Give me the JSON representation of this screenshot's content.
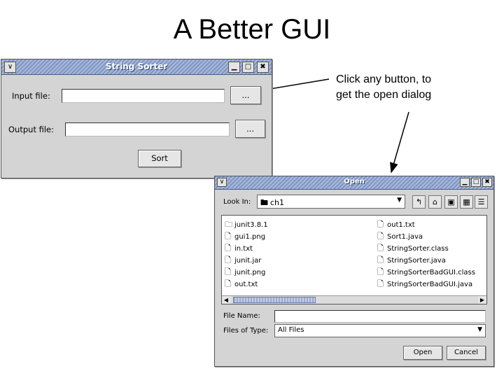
{
  "slide": {
    "title": "A Better GUI",
    "annotation_line1": "Click any button, to",
    "annotation_line2": "get the open dialog"
  },
  "string_sorter": {
    "title": "String Sorter",
    "input_label": "Input file:",
    "input_value": "",
    "browse_label": "...",
    "output_label": "Output file:",
    "output_value": "",
    "sort_label": "Sort"
  },
  "open_dialog": {
    "title": "Open",
    "look_in_label": "Look In:",
    "look_in_value": "ch1",
    "files_left": [
      "junit3.8.1",
      "gui1.png",
      "in.txt",
      "junit.jar",
      "junit.png",
      "out.txt"
    ],
    "files_right": [
      "out1.txt",
      "Sort1.java",
      "StringSorter.class",
      "StringSorter.java",
      "StringSorterBadGUI.class",
      "StringSorterBadGUI.java"
    ],
    "file_name_label": "File Name:",
    "file_name_value": "",
    "files_of_type_label": "Files of Type:",
    "files_of_type_value": "All Files",
    "open_label": "Open",
    "cancel_label": "Cancel"
  },
  "window_controls": {
    "menu": "∨",
    "minimize": "▁",
    "maximize": "□",
    "close": "✖"
  },
  "colors": {
    "titlebar": "#8fa2cc",
    "window_bg": "#d4d4d4"
  }
}
